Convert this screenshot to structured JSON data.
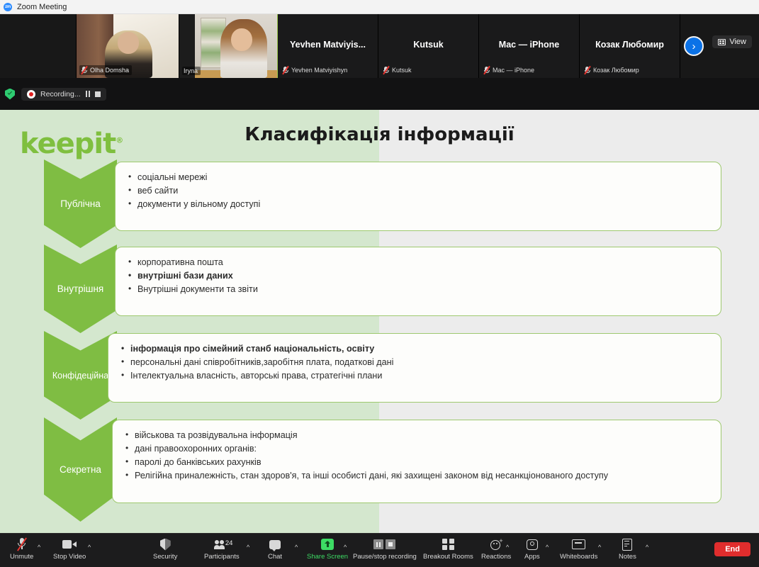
{
  "window": {
    "title": "Zoom Meeting",
    "app_icon": "zoom-logo-icon"
  },
  "video_strip": {
    "view_button": {
      "label": "View",
      "icon": "grid-view-icon"
    },
    "next_button": {
      "icon": "chevron-right-icon",
      "glyph": "›"
    },
    "tiles": [
      {
        "display_name": "",
        "badge_name": "Olha Domsha",
        "muted": true,
        "has_video": true,
        "active_speaker": false
      },
      {
        "display_name": "",
        "badge_name": "Iryna",
        "muted": false,
        "has_video": true,
        "active_speaker": true
      },
      {
        "display_name": "Yevhen  Matviyis...",
        "badge_name": "Yevhen Matviyishyn",
        "muted": true,
        "has_video": false,
        "active_speaker": false
      },
      {
        "display_name": "Kutsuk",
        "badge_name": "Kutsuk",
        "muted": true,
        "has_video": false,
        "active_speaker": false
      },
      {
        "display_name": "Mac — iPhone",
        "badge_name": "Mac — iPhone",
        "muted": true,
        "has_video": false,
        "active_speaker": false
      },
      {
        "display_name": "Козак Любомир",
        "badge_name": "Козак Любомир",
        "muted": true,
        "has_video": false,
        "active_speaker": false
      }
    ]
  },
  "recording_bar": {
    "shield_icon": "encryption-shield-icon",
    "status_text": "Recording...",
    "pause_icon": "pause-recording-icon",
    "stop_icon": "stop-recording-icon"
  },
  "slide": {
    "logo_text": "keepit",
    "logo_registered": "®",
    "title": "Класифікація інформації",
    "accent_color": "#7fbd43",
    "band_color": "#d4e7ce",
    "rows": [
      {
        "label": "Публічна",
        "items": [
          " соціальні мережі",
          "веб сайти",
          "документи у вільному доступі"
        ]
      },
      {
        "label": "Внутрішня",
        "items": [
          " корпоративна пошта",
          "внутрішні бази даних",
          "Внутрішні документи та звіти"
        ]
      },
      {
        "label": "Конфідеційна",
        "items": [
          "інформація про сімейний станб національність, освіту",
          " персональні дані співробітників,заробітня плата, податкові дані",
          "Інтелектуальна власність, авторські права, стратегічні плани"
        ]
      },
      {
        "label": "Секретна",
        "items": [
          "військова та розвідувальна інформація",
          "дані правоохоронних органів:",
          " паролі до банківських рахунків",
          "Релігійна приналежність, стан здоров'я, та інші особисті дані, які захищені законом від несанкціонованого доступу"
        ]
      }
    ]
  },
  "toolbar": {
    "share_screen_color": "#3ddc64",
    "end_color": "#e02d2d",
    "participants_count": "24",
    "items": [
      {
        "label": "Unmute",
        "icon": "microphone-muted-icon",
        "caret": true
      },
      {
        "label": "Stop Video",
        "icon": "camera-icon",
        "caret": true
      },
      {
        "label": "Security",
        "icon": "shield-icon",
        "caret": false
      },
      {
        "label": "Participants",
        "icon": "people-icon",
        "caret": true
      },
      {
        "label": "Chat",
        "icon": "chat-bubble-icon",
        "caret": true
      },
      {
        "label": "Share Screen",
        "icon": "share-screen-icon",
        "caret": true
      },
      {
        "label": "Pause/stop recording",
        "icon": "pause-stop-recording-icon",
        "caret": false
      },
      {
        "label": "Breakout Rooms",
        "icon": "breakout-rooms-icon",
        "caret": false
      },
      {
        "label": "Reactions",
        "icon": "reactions-icon",
        "caret": true
      },
      {
        "label": "Apps",
        "icon": "apps-icon",
        "caret": true
      },
      {
        "label": "Whiteboards",
        "icon": "whiteboard-icon",
        "caret": true
      },
      {
        "label": "Notes",
        "icon": "notes-icon",
        "caret": true
      }
    ],
    "end_label": "End"
  }
}
